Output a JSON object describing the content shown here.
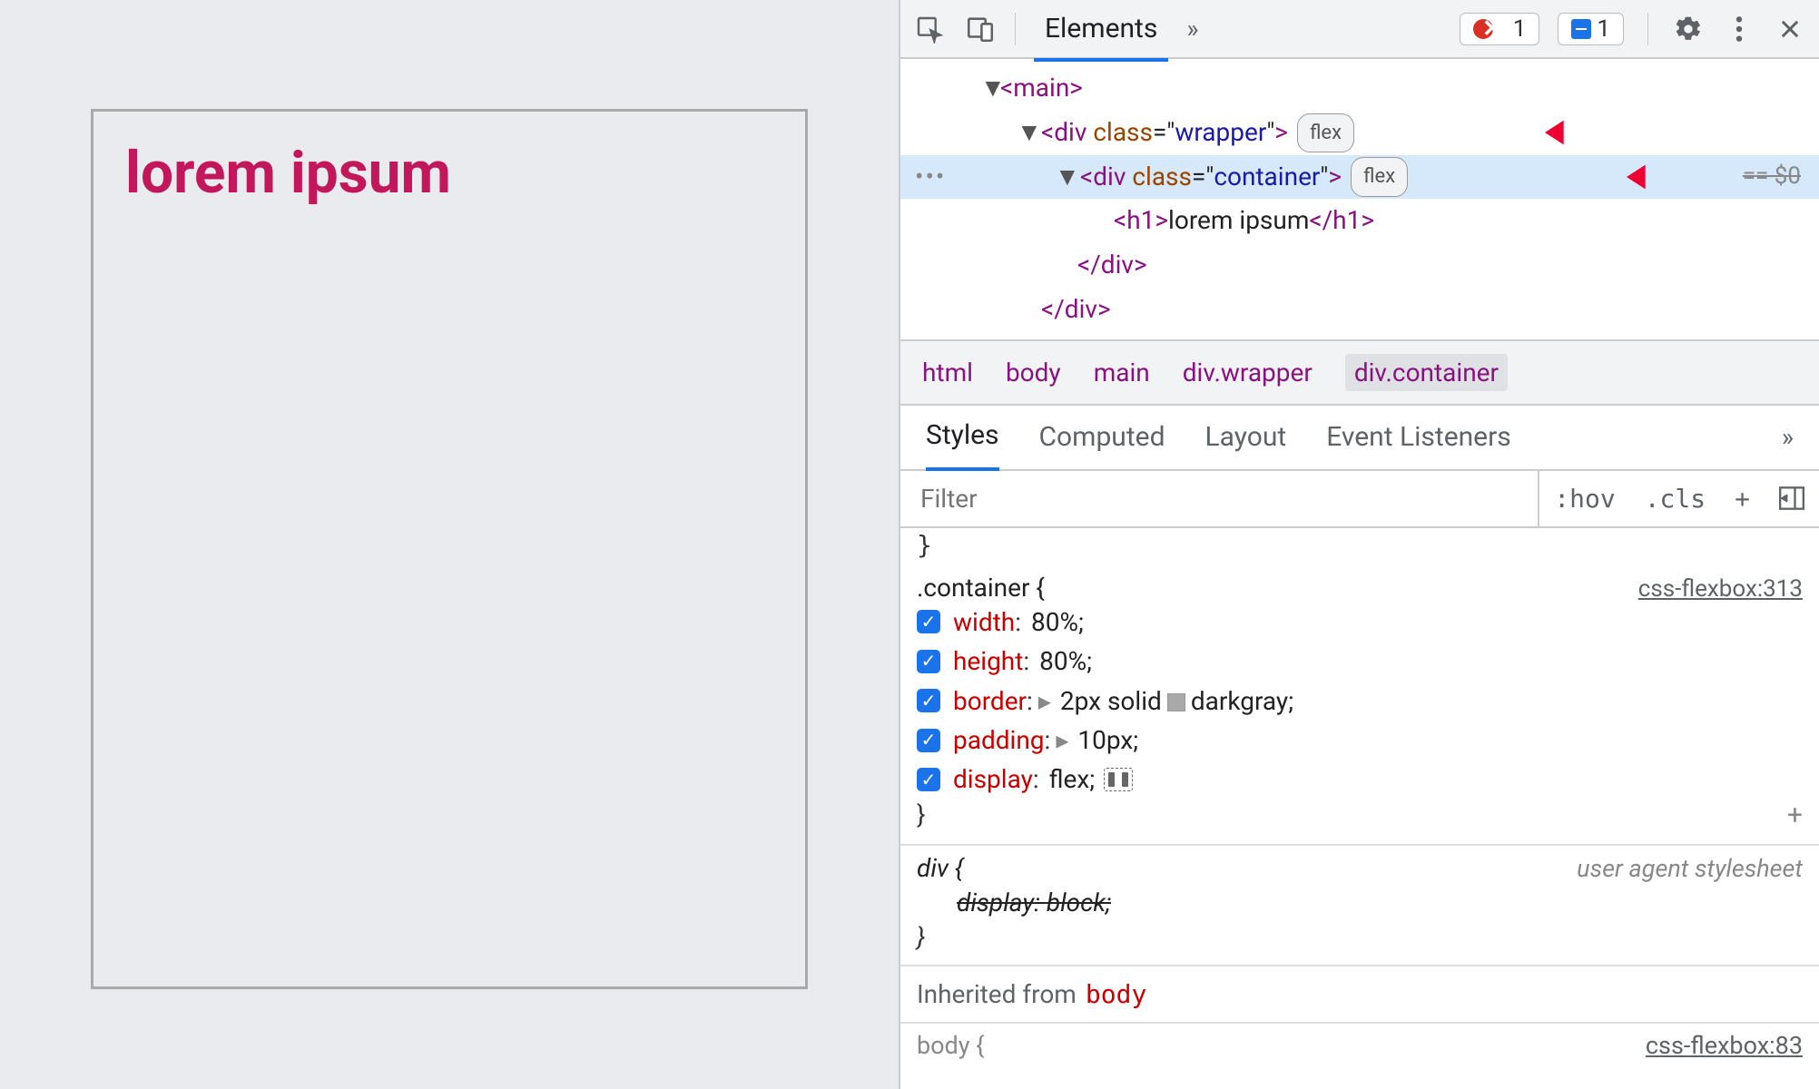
{
  "preview": {
    "heading": "lorem ipsum"
  },
  "toolbar": {
    "tab_elements": "Elements",
    "errors": "1",
    "messages": "1"
  },
  "dom": {
    "main": "<main>",
    "wrapper": {
      "open": "<",
      "tag": "div",
      "attr_name": "class",
      "attr_val": "wrapper",
      "close": ">",
      "pill": "flex"
    },
    "container": {
      "open": "<",
      "tag": "div",
      "attr_name": "class",
      "attr_val": "container",
      "close": ">",
      "pill": "flex",
      "ref": "== $0"
    },
    "h1": {
      "open": "<h1>",
      "text": "lorem ipsum",
      "close": "</h1>"
    },
    "cdiv1": "</div>",
    "cdiv2": "</div>"
  },
  "breadcrumb": [
    "html",
    "body",
    "main",
    "div.wrapper",
    "div.container"
  ],
  "styles_tabs": [
    "Styles",
    "Computed",
    "Layout",
    "Event Listeners"
  ],
  "filter_placeholder": "Filter",
  "filter_btns": {
    "hov": ":hov",
    "cls": ".cls"
  },
  "rule_container": {
    "selector": ".container {",
    "source": "css-flexbox:313",
    "close": "}",
    "decls": [
      {
        "prop": "width",
        "val": "80%"
      },
      {
        "prop": "height",
        "val": "80%"
      },
      {
        "prop": "border",
        "val_prefix": "2px solid",
        "val_suffix": "darkgray",
        "expand": true,
        "swatch": true
      },
      {
        "prop": "padding",
        "val": "10px",
        "expand": true
      },
      {
        "prop": "display",
        "val": "flex",
        "flex_icon": true
      }
    ]
  },
  "rule_div": {
    "selector": "div {",
    "ua": "user agent stylesheet",
    "decl_struck": {
      "prop": "display",
      "val": "block"
    },
    "close": "}"
  },
  "inherit_label": "Inherited from",
  "inherit_from": "body",
  "partial": {
    "sel": "body {",
    "src": "css-flexbox:83"
  }
}
